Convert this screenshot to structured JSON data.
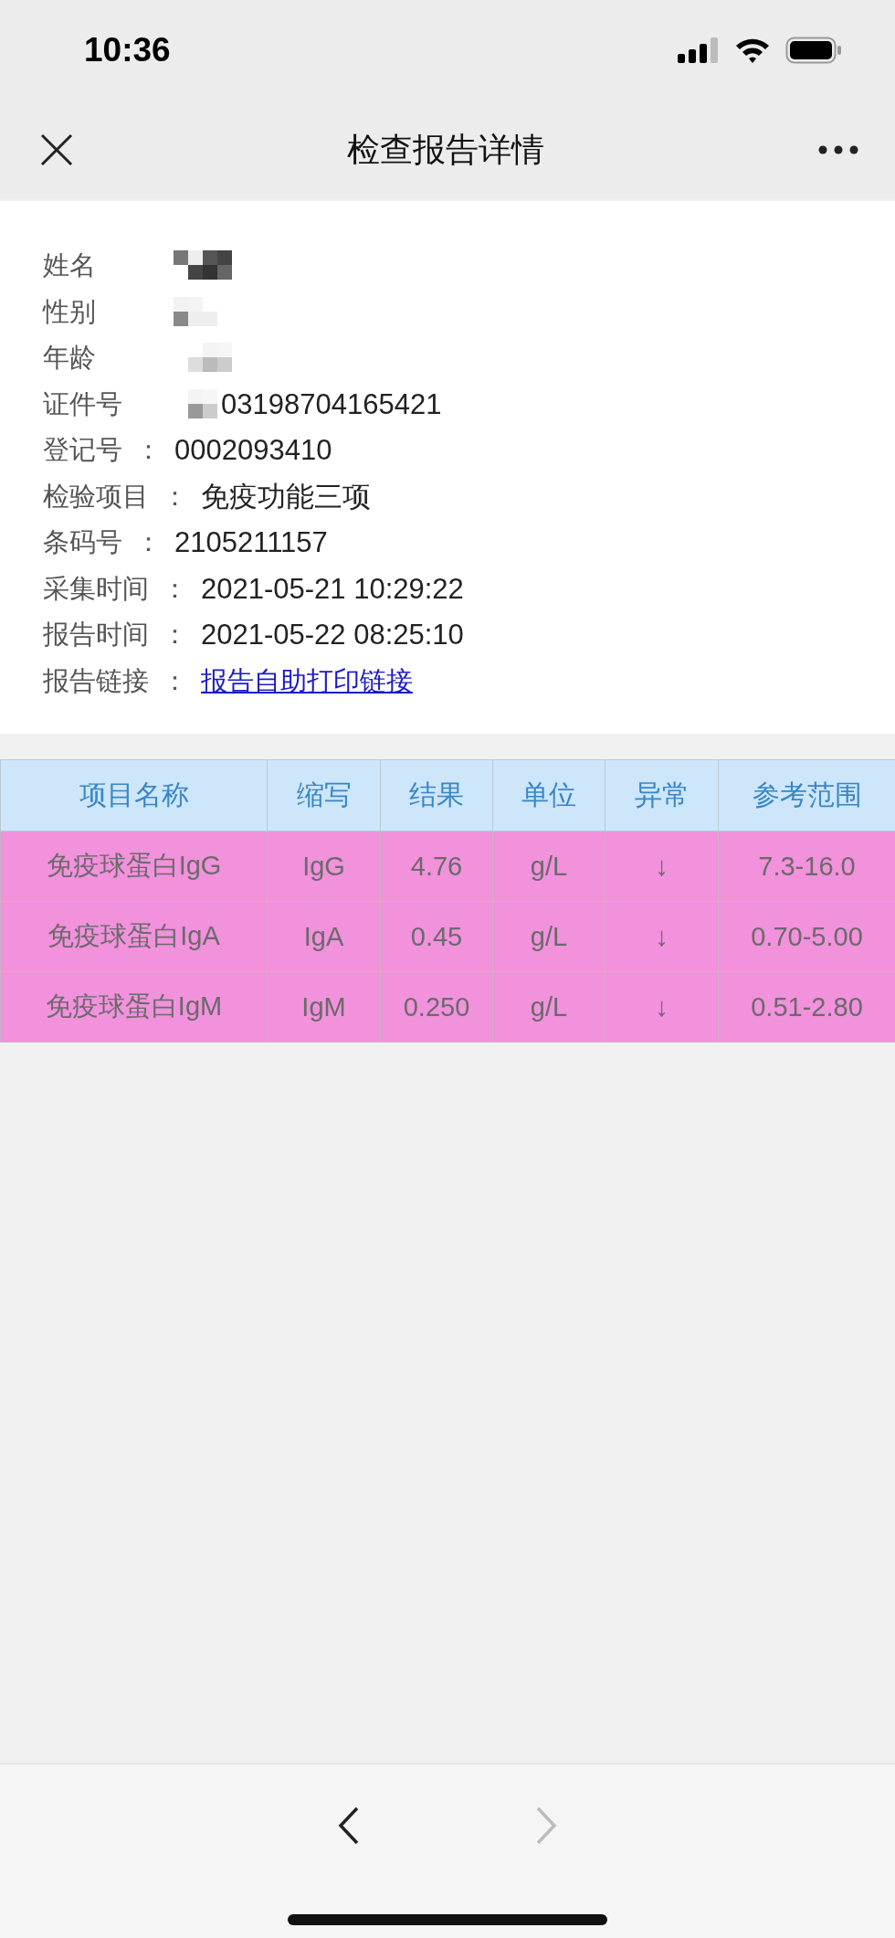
{
  "status_bar": {
    "time": "10:36"
  },
  "nav": {
    "title": "检查报告详情"
  },
  "info": [
    {
      "label": "姓名",
      "kind": "redacted"
    },
    {
      "label": "性别",
      "kind": "redacted"
    },
    {
      "label": "年龄",
      "kind": "redacted"
    },
    {
      "label": "证件号",
      "kind": "partial",
      "value": "03198704165421"
    },
    {
      "label": "登记号",
      "kind": "text",
      "colon": "：",
      "value": "0002093410"
    },
    {
      "label": "检验项目",
      "kind": "text",
      "colon": "：",
      "value": "免疫功能三项"
    },
    {
      "label": "条码号",
      "kind": "text",
      "colon": "：",
      "value": "2105211157"
    },
    {
      "label": "采集时间",
      "kind": "text",
      "colon": "：",
      "value": "2021-05-21 10:29:22"
    },
    {
      "label": "报告时间",
      "kind": "text",
      "colon": "：",
      "value": "2021-05-22 08:25:10"
    },
    {
      "label": "报告链接",
      "kind": "link",
      "colon": "：",
      "value": "报告自助打印链接"
    }
  ],
  "table": {
    "columns": [
      "项目名称",
      "缩写",
      "结果",
      "单位",
      "异常",
      "参考范围"
    ],
    "rows": [
      {
        "cells": [
          "免疫球蛋白IgG",
          "IgG",
          "4.76",
          "g/L",
          "↓",
          "7.3-16.0"
        ]
      },
      {
        "cells": [
          "免疫球蛋白IgA",
          "IgA",
          "0.45",
          "g/L",
          "↓",
          "0.70-5.00"
        ]
      },
      {
        "cells": [
          "免疫球蛋白IgM",
          "IgM",
          "0.250",
          "g/L",
          "↓",
          "0.51-2.80"
        ]
      }
    ]
  },
  "bottom_bar": {
    "back": {
      "disabled": false
    },
    "forward": {
      "disabled": true
    }
  }
}
